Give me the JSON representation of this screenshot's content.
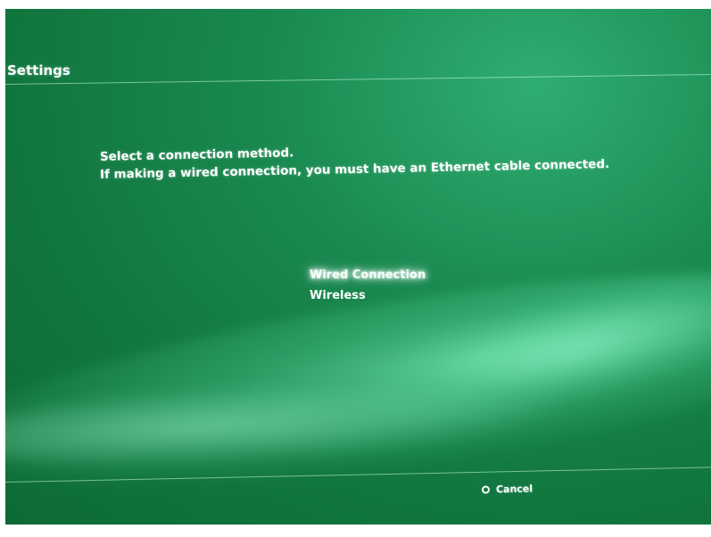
{
  "header": {
    "title": "Settings"
  },
  "prompt": {
    "line1": "Select a connection method.",
    "line2": "If making a wired connection, you must have an Ethernet cable connected."
  },
  "menu": {
    "items": [
      {
        "label": "Wired Connection",
        "selected": true
      },
      {
        "label": "Wireless",
        "selected": false
      }
    ]
  },
  "footer": {
    "cancel_icon": "circle-icon",
    "cancel_label": "Cancel"
  },
  "colors": {
    "background": "#1a8a50",
    "text": "#ffffff",
    "highlight_glow": "#ffffff"
  }
}
